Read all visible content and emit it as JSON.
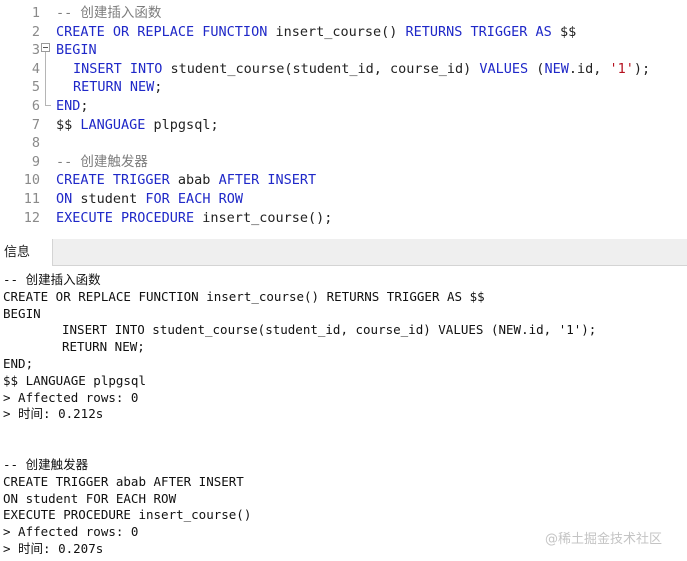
{
  "editor": {
    "line_numbers": [
      "1",
      "2",
      "3",
      "4",
      "5",
      "6",
      "7",
      "8",
      "9",
      "10",
      "11",
      "12"
    ],
    "l1_comment": "-- 创建插入函数",
    "l2_k1": "CREATE OR REPLACE FUNCTION",
    "l2_t1": " insert_course() ",
    "l2_k2": "RETURNS TRIGGER AS",
    "l2_t2": " $$",
    "l3_kw": "BEGIN",
    "l4_k1": "INSERT INTO",
    "l4_t1": " student_course(student_id, course_id) ",
    "l4_k2": "VALUES",
    "l4_t2": " (",
    "l4_k3": "NEW",
    "l4_t3": ".id, ",
    "l4_str": "'1'",
    "l4_t4": ");",
    "l5_k1": "RETURN NEW",
    "l5_t1": ";",
    "l6_kw": "END",
    "l6_t1": ";",
    "l7_t1": "$$ ",
    "l7_k1": "LANGUAGE",
    "l7_t2": " plpgsql;",
    "l9_comment": "-- 创建触发器",
    "l10_k1": "CREATE TRIGGER",
    "l10_t1": " abab ",
    "l10_k2": "AFTER INSERT",
    "l11_k1": "ON",
    "l11_t1": " student ",
    "l11_k2": "FOR EACH ROW",
    "l12_k1": "EXECUTE PROCEDURE",
    "l12_t1": " insert_course();"
  },
  "tabs": {
    "info_label": "信息"
  },
  "output": {
    "lines": [
      "-- 创建插入函数",
      "CREATE OR REPLACE FUNCTION insert_course() RETURNS TRIGGER AS $$",
      "BEGIN",
      "INSERT INTO student_course(student_id, course_id) VALUES (NEW.id, '1');",
      "RETURN NEW;",
      "END;",
      "$$ LANGUAGE plpgsql",
      "> Affected rows: 0",
      "> 时间: 0.212s",
      "-- 创建触发器",
      "CREATE TRIGGER abab AFTER INSERT",
      "ON student FOR EACH ROW",
      "EXECUTE PROCEDURE insert_course()",
      "> Affected rows: 0",
      "> 时间: 0.207s"
    ]
  },
  "watermark": "@稀土掘金技术社区",
  "colors": {
    "keyword": "#1f28c8",
    "comment": "#7d7d7d",
    "string": "#b5101e",
    "line_number": "#8a8a8a"
  }
}
